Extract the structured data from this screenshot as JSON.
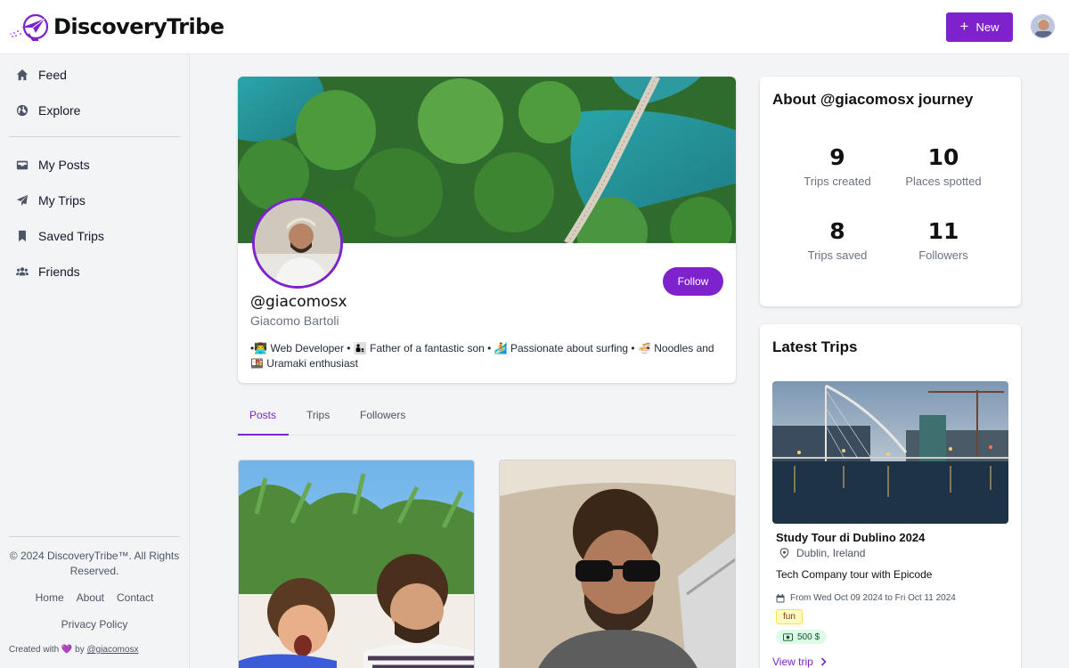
{
  "header": {
    "brand": "DiscoveryTribe",
    "new_label": "New",
    "new_icon": "plus-icon"
  },
  "sidebar": {
    "primary": [
      {
        "label": "Feed",
        "icon": "home-icon"
      },
      {
        "label": "Explore",
        "icon": "globe-icon"
      }
    ],
    "secondary": [
      {
        "label": "My Posts",
        "icon": "inbox-icon"
      },
      {
        "label": "My Trips",
        "icon": "paper-plane-icon"
      },
      {
        "label": "Saved Trips",
        "icon": "bookmark-icon"
      },
      {
        "label": "Friends",
        "icon": "users-icon"
      }
    ],
    "copyright": "© 2024 DiscoveryTribe™. All Rights Reserved.",
    "links": [
      "Home",
      "About",
      "Contact"
    ],
    "privacy": "Privacy Policy",
    "created_prefix": "Created with",
    "created_heart": "💜",
    "created_by": "by",
    "created_author": "@giacomosx"
  },
  "profile": {
    "handle": "@giacomosx",
    "name": "Giacomo Bartoli",
    "bio": "•👨‍💻 Web Developer • 👨‍👦 Father of a fantastic son • 🏄 Passionate about surfing • 🍜 Noodles and 🍱 Uramaki enthusiast",
    "follow_label": "Follow"
  },
  "tabs": [
    {
      "label": "Posts",
      "active": true
    },
    {
      "label": "Trips",
      "active": false
    },
    {
      "label": "Followers",
      "active": false
    }
  ],
  "about": {
    "title": "About @giacomosx journey",
    "stats": [
      {
        "value": "9",
        "label": "Trips created"
      },
      {
        "value": "10",
        "label": "Places spotted"
      },
      {
        "value": "8",
        "label": "Trips saved"
      },
      {
        "value": "11",
        "label": "Followers"
      }
    ]
  },
  "latest": {
    "title": "Latest Trips",
    "trip": {
      "title": "Study Tour di Dublino 2024",
      "location": "Dublin, Ireland",
      "description": "Tech Company tour with Epicode",
      "dates": "From Wed Oct 09 2024 to Fri Oct 11 2024",
      "tag": "fun",
      "budget": "500 $",
      "view_label": "View trip"
    }
  },
  "colors": {
    "accent": "#7e22ce",
    "tag_fun_bg": "#fef9c3",
    "tag_money_bg": "#dcfce7"
  }
}
